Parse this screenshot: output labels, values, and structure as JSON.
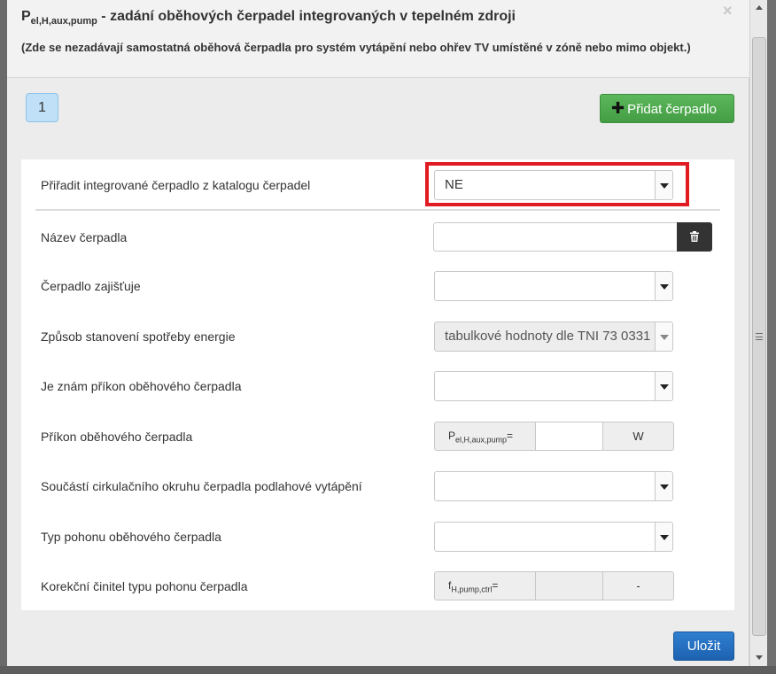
{
  "modal": {
    "title_symbol": "P",
    "title_sub": "el,H,aux,pump",
    "title_text": " - zadání oběhových čerpadel integrovaných v tepelném zdroji",
    "subtitle": "(Zde se nezadávají samostatná oběhová čerpadla pro systém vytápění nebo ohřev TV umístěné v zóně nebo mimo objekt.)",
    "close_label": "×",
    "tab_label": "1",
    "add_button_plus": "✚",
    "add_button_label": "Přidat čerpadlo",
    "save_label": "Uložit"
  },
  "form": {
    "assign": {
      "label": "Přiřadit integrované čerpadlo z katalogu čerpadel",
      "value": "NE"
    },
    "name": {
      "label": "Název čerpadla",
      "value": ""
    },
    "provides": {
      "label": "Čerpadlo zajišťuje",
      "value": ""
    },
    "method": {
      "label": "Způsob stanovení spotřeby energie",
      "value": "tabulkové hodnoty dle TNI 73 0331"
    },
    "known_power": {
      "label": "Je znám příkon oběhového čerpadla",
      "value": ""
    },
    "power": {
      "label": "Příkon oběhového čerpadla",
      "addon_symbol": "P",
      "addon_sub": "el,H,aux,pump",
      "addon_eq": "=",
      "unit": "W"
    },
    "floor_heating": {
      "label": "Součástí cirkulačního okruhu čerpadla podlahové vytápění",
      "value": ""
    },
    "drive_type": {
      "label": "Typ pohonu oběhového čerpadla",
      "value": ""
    },
    "correction": {
      "label": "Korekční činitel typu pohonu čerpadla",
      "addon_symbol": "f",
      "addon_sub": "H,pump,ctrl",
      "addon_eq": "=",
      "unit": "-"
    }
  },
  "colors": {
    "highlight": "#e01b22",
    "add_button": "#5cb85c",
    "save_button": "#2a78c8",
    "tab": "#bfe0f7"
  }
}
